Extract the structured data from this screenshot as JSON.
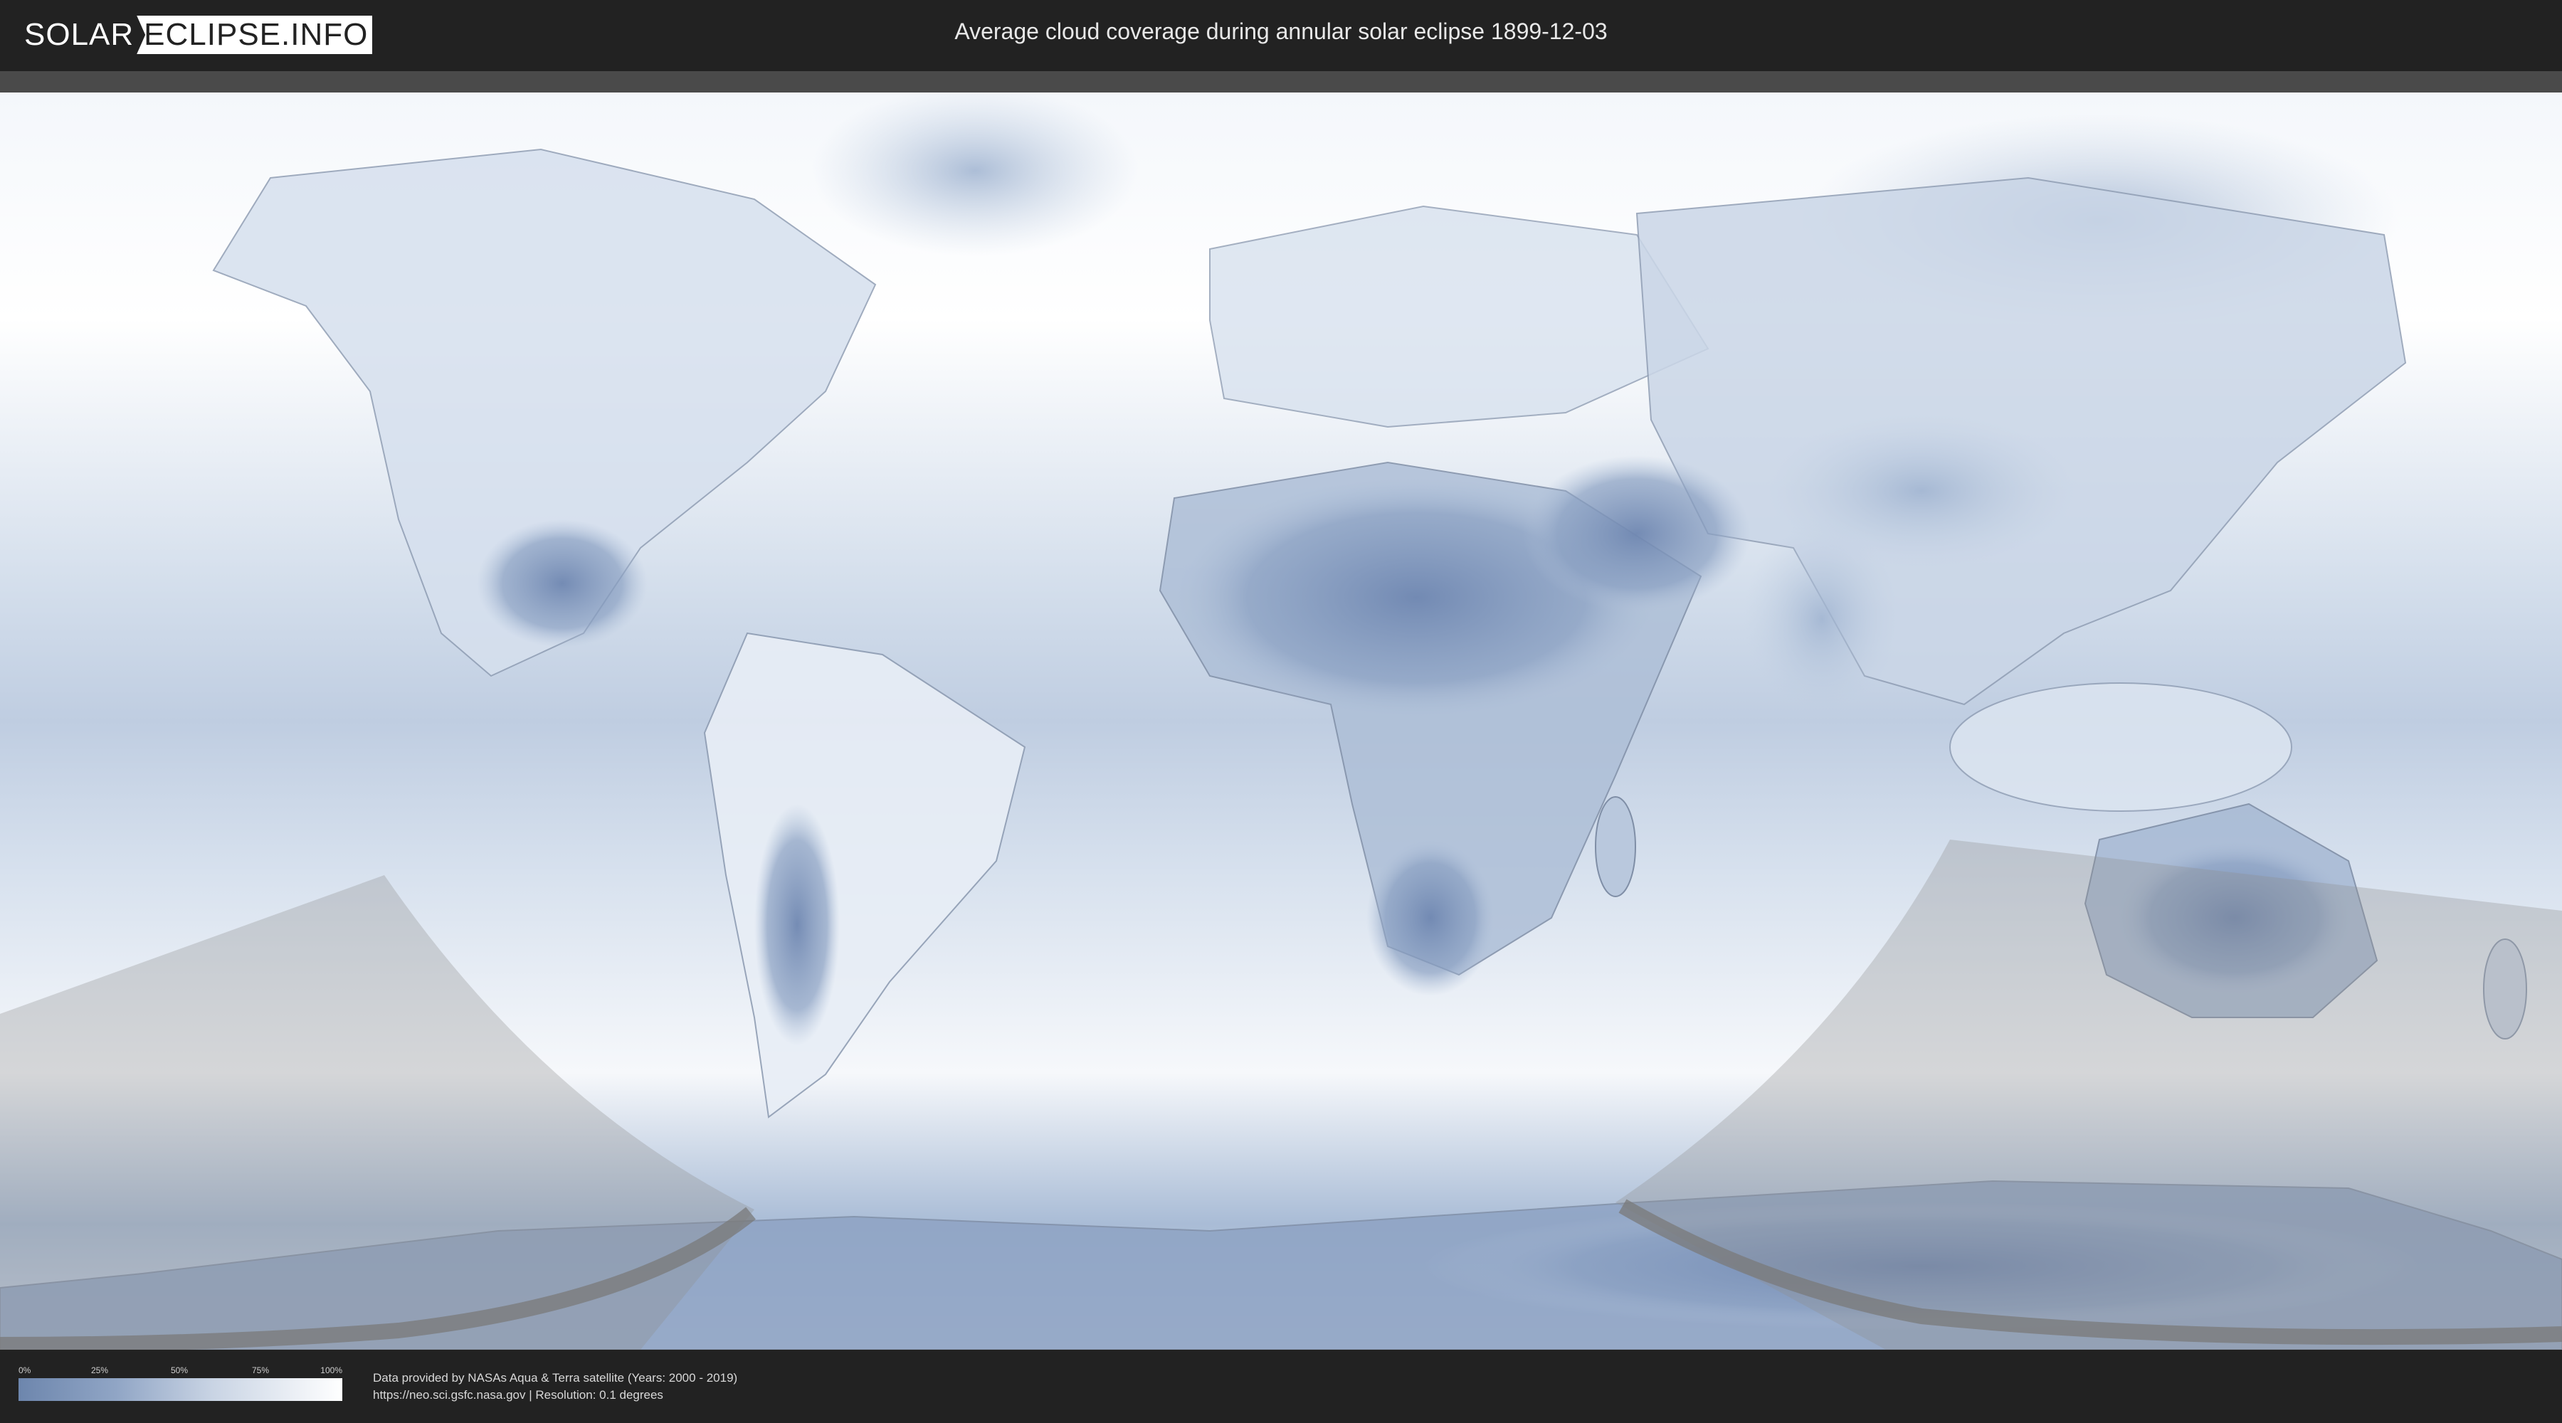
{
  "header": {
    "logo_left": "SOLAR",
    "logo_right": "ECLIPSE.INFO",
    "title": "Average cloud coverage during annular solar eclipse 1899-12-03"
  },
  "legend": {
    "ticks": [
      "0%",
      "25%",
      "50%",
      "75%",
      "100%"
    ],
    "gradient_colors": [
      "#6d86ad",
      "#ffffff"
    ]
  },
  "credits": {
    "line1": "Data provided by NASAs Aqua & Terra satellite (Years: 2000 - 2019)",
    "line2": "https://neo.sci.gsfc.nasa.gov | Resolution: 0.1 degrees"
  },
  "colors": {
    "header_bg": "#222222",
    "ocean_cloud": "#dde6f1",
    "low_cloud": "#7088b2",
    "shadow": "#9a9a9a",
    "path": "#777777"
  }
}
